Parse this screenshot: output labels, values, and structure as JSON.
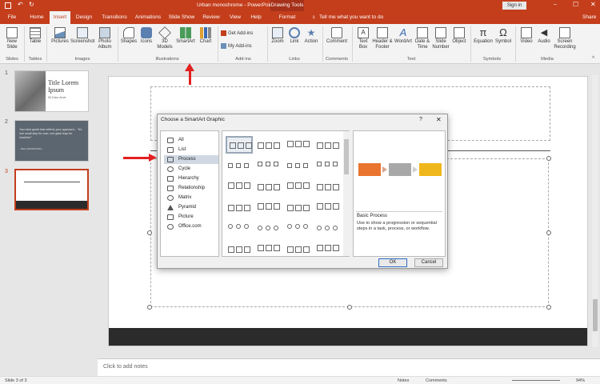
{
  "window": {
    "title": "Urban monochrome  -  PowerPoint",
    "contextual": "Drawing Tools",
    "sign_in": "Sign in"
  },
  "tabs": [
    "File",
    "Home",
    "Insert",
    "Design",
    "Transitions",
    "Animations",
    "Slide Show",
    "Review",
    "View",
    "Help",
    "Format"
  ],
  "tell_me": "Tell me what you want to do",
  "share": "Share",
  "ribbon": {
    "new_slide": "New Slide",
    "table": "Table",
    "pictures": "Pictures",
    "screenshot": "Screenshot",
    "photo_album": "Photo Album",
    "shapes": "Shapes",
    "icons": "Icons",
    "models3d": "3D Models",
    "smartart": "SmartArt",
    "chart": "Chart",
    "get_addins": "Get Add-ins",
    "my_addins": "My Add-ins",
    "zoom": "Zoom",
    "link": "Link",
    "action": "Action",
    "comment": "Comment",
    "textbox": "Text Box",
    "header_footer": "Header & Footer",
    "wordart": "WordArt",
    "date_time": "Date & Time",
    "slide_number": "Slide Number",
    "object": "Object",
    "equation": "Equation",
    "symbol": "Symbol",
    "video": "Video",
    "audio": "Audio",
    "screen_recording": "Screen Recording",
    "groups": {
      "slides": "Slides",
      "tables": "Tables",
      "images": "Images",
      "illustrations": "Illustrations",
      "addins": "Add-ins",
      "links": "Links",
      "comments": "Comments",
      "text": "Text",
      "symbols": "Symbols",
      "media": "Media"
    }
  },
  "thumbs": {
    "n1": "1",
    "n2": "2",
    "n3": "3",
    "t1_title": "Title Lorem Ipsum",
    "t1_sub": "Sit Dolor Amet",
    "t2_quote": "Your best quote that reflects your approach... \"It's one small step for man, one giant leap for mankind.\"",
    "t2_author": "- NEIL ARMSTRONG"
  },
  "notes_placeholder": "Click to add notes",
  "status": {
    "slide": "Slide 3 of 3",
    "notes": "Notes",
    "comments": "Comments",
    "zoom": "94%"
  },
  "dialog": {
    "title": "Choose a SmartArt Graphic",
    "help": "?",
    "close": "✕",
    "categories": [
      "All",
      "List",
      "Process",
      "Cycle",
      "Hierarchy",
      "Relationship",
      "Matrix",
      "Pyramid",
      "Picture",
      "Office.com"
    ],
    "preview_name": "Basic Process",
    "preview_desc": "Use to show a progression or sequential steps in a task, process, or workflow.",
    "ok": "OK",
    "cancel": "Cancel",
    "preview_colors": [
      "#e8742f",
      "#a8a8a8",
      "#f0b71c"
    ]
  },
  "colors": {
    "accent": "#c43e1c",
    "arrow": "#e32020"
  }
}
